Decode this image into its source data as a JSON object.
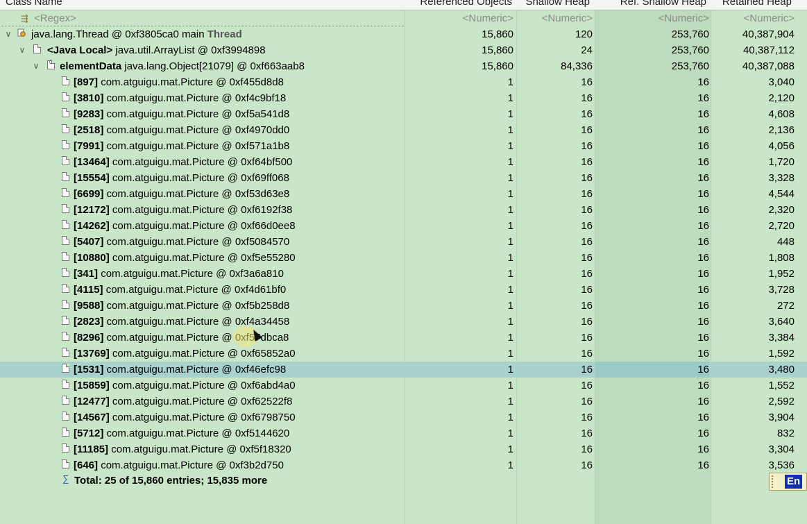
{
  "columns": [
    "Class Name",
    "Referenced Objects",
    "Shallow Heap",
    "Ref. Shallow Heap",
    "Retained Heap"
  ],
  "filter_row": {
    "name": "<Regex>",
    "referenced": "<Numeric>",
    "shallow": "<Numeric>",
    "ref_shallow": "<Numeric>",
    "retained": "<Numeric>"
  },
  "tree": [
    {
      "toggle": "∨",
      "plain": "java.lang.Thread @ 0xf3805ca0  main ",
      "suffix": "Thread",
      "referenced": "15,860",
      "shallow": "120",
      "ref_shallow": "253,760",
      "retained": "40,387,904"
    },
    {
      "toggle": "∨",
      "bold": "<Java Local>",
      "plain": " java.util.ArrayList @ 0xf3994898",
      "referenced": "15,860",
      "shallow": "24",
      "ref_shallow": "253,760",
      "retained": "40,387,112"
    },
    {
      "toggle": "∨",
      "bold": "elementData",
      "plain": " java.lang.Object[21079] @ 0xf663aab8",
      "referenced": "15,860",
      "shallow": "84,336",
      "ref_shallow": "253,760",
      "retained": "40,387,088"
    }
  ],
  "items": [
    {
      "index": "[897]",
      "name": " com.atguigu.mat.Picture @ 0xf455d8d8",
      "referenced": "1",
      "shallow": "16",
      "ref_shallow": "16",
      "retained": "3,040"
    },
    {
      "index": "[3810]",
      "name": " com.atguigu.mat.Picture @ 0xf4c9bf18",
      "referenced": "1",
      "shallow": "16",
      "ref_shallow": "16",
      "retained": "2,120"
    },
    {
      "index": "[9283]",
      "name": " com.atguigu.mat.Picture @ 0xf5a541d8",
      "referenced": "1",
      "shallow": "16",
      "ref_shallow": "16",
      "retained": "4,608"
    },
    {
      "index": "[2518]",
      "name": " com.atguigu.mat.Picture @ 0xf4970dd0",
      "referenced": "1",
      "shallow": "16",
      "ref_shallow": "16",
      "retained": "2,136"
    },
    {
      "index": "[7991]",
      "name": " com.atguigu.mat.Picture @ 0xf571a1b8",
      "referenced": "1",
      "shallow": "16",
      "ref_shallow": "16",
      "retained": "4,056"
    },
    {
      "index": "[13464]",
      "name": " com.atguigu.mat.Picture @ 0xf64bf500",
      "referenced": "1",
      "shallow": "16",
      "ref_shallow": "16",
      "retained": "1,720"
    },
    {
      "index": "[15554]",
      "name": " com.atguigu.mat.Picture @ 0xf69ff068",
      "referenced": "1",
      "shallow": "16",
      "ref_shallow": "16",
      "retained": "3,328"
    },
    {
      "index": "[6699]",
      "name": " com.atguigu.mat.Picture @ 0xf53d63e8",
      "referenced": "1",
      "shallow": "16",
      "ref_shallow": "16",
      "retained": "4,544"
    },
    {
      "index": "[12172]",
      "name": " com.atguigu.mat.Picture @ 0xf6192f38",
      "referenced": "1",
      "shallow": "16",
      "ref_shallow": "16",
      "retained": "2,320"
    },
    {
      "index": "[14262]",
      "name": " com.atguigu.mat.Picture @ 0xf66d0ee8",
      "referenced": "1",
      "shallow": "16",
      "ref_shallow": "16",
      "retained": "2,720"
    },
    {
      "index": "[5407]",
      "name": " com.atguigu.mat.Picture @ 0xf5084570",
      "referenced": "1",
      "shallow": "16",
      "ref_shallow": "16",
      "retained": "448"
    },
    {
      "index": "[10880]",
      "name": " com.atguigu.mat.Picture @ 0xf5e55280",
      "referenced": "1",
      "shallow": "16",
      "ref_shallow": "16",
      "retained": "1,808"
    },
    {
      "index": "[341]",
      "name": " com.atguigu.mat.Picture @ 0xf3a6a810",
      "referenced": "1",
      "shallow": "16",
      "ref_shallow": "16",
      "retained": "1,952"
    },
    {
      "index": "[4115]",
      "name": " com.atguigu.mat.Picture @ 0xf4d61bf0",
      "referenced": "1",
      "shallow": "16",
      "ref_shallow": "16",
      "retained": "3,728"
    },
    {
      "index": "[9588]",
      "name": " com.atguigu.mat.Picture @ 0xf5b258d8",
      "referenced": "1",
      "shallow": "16",
      "ref_shallow": "16",
      "retained": "272"
    },
    {
      "index": "[2823]",
      "name": " com.atguigu.mat.Picture @ 0xf4a34458",
      "referenced": "1",
      "shallow": "16",
      "ref_shallow": "16",
      "retained": "3,640"
    },
    {
      "index": "[8296]",
      "name": " com.atguigu.mat.Picture @ 0xf57dbca8",
      "referenced": "1",
      "shallow": "16",
      "ref_shallow": "16",
      "retained": "3,384"
    },
    {
      "index": "[13769]",
      "name": " com.atguigu.mat.Picture @ 0xf65852a0",
      "referenced": "1",
      "shallow": "16",
      "ref_shallow": "16",
      "retained": "1,592"
    },
    {
      "index": "[1531]",
      "name": " com.atguigu.mat.Picture @ 0xf46efc98",
      "referenced": "1",
      "shallow": "16",
      "ref_shallow": "16",
      "retained": "3,480",
      "selected": true
    },
    {
      "index": "[15859]",
      "name": " com.atguigu.mat.Picture @ 0xf6abd4a0",
      "referenced": "1",
      "shallow": "16",
      "ref_shallow": "16",
      "retained": "1,552"
    },
    {
      "index": "[12477]",
      "name": " com.atguigu.mat.Picture @ 0xf62522f8",
      "referenced": "1",
      "shallow": "16",
      "ref_shallow": "16",
      "retained": "2,592"
    },
    {
      "index": "[14567]",
      "name": " com.atguigu.mat.Picture @ 0xf6798750",
      "referenced": "1",
      "shallow": "16",
      "ref_shallow": "16",
      "retained": "3,904"
    },
    {
      "index": "[5712]",
      "name": " com.atguigu.mat.Picture @ 0xf5144620",
      "referenced": "1",
      "shallow": "16",
      "ref_shallow": "16",
      "retained": "832"
    },
    {
      "index": "[11185]",
      "name": " com.atguigu.mat.Picture @ 0xf5f18320",
      "referenced": "1",
      "shallow": "16",
      "ref_shallow": "16",
      "retained": "3,304"
    },
    {
      "index": "[646]",
      "name": " com.atguigu.mat.Picture @ 0xf3b2d750",
      "referenced": "1",
      "shallow": "16",
      "ref_shallow": "16",
      "retained": "3,536"
    }
  ],
  "total": "Total: 25 of 15,860 entries; 15,835 more",
  "ime": "En",
  "icons": {
    "filter": "regex-filter-icon",
    "thread": "thread-icon",
    "object": "object-icon",
    "array": "array-icon",
    "total": "sigma-icon",
    "expand": "chevron-down-icon"
  },
  "colors": {
    "background": "#c9e6c9",
    "selected_row": "#a9d2cf",
    "ref_shallow_column": "#bddbbd"
  }
}
